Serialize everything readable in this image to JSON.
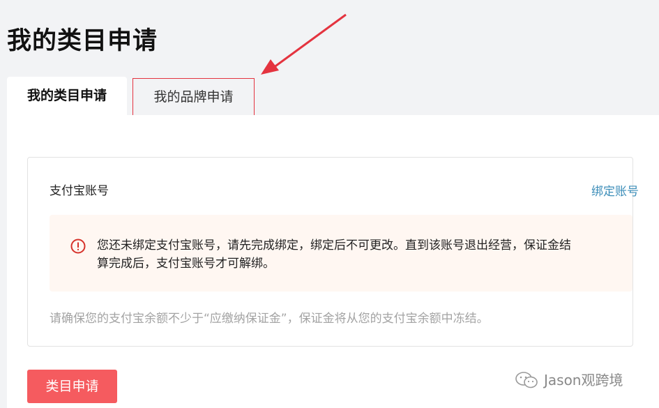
{
  "page": {
    "title": "我的类目申请"
  },
  "tabs": [
    {
      "label": "我的类目申请",
      "active": true
    },
    {
      "label": "我的品牌申请",
      "active": false
    }
  ],
  "alipay_card": {
    "title": "支付宝账号",
    "bind_link": "绑定账号",
    "notice_icon": "exclamation-circle-icon",
    "notice_text": "您还未绑定支付宝账号，请先完成绑定，绑定后不可更改。直到该账号退出经营，保证金结算完成后，支付宝账号才可解绑。",
    "hint": "请确保您的支付宝余额不少于“应缴纳保证金”，保证金将从您的支付宝余额中冻结。"
  },
  "actions": {
    "apply_button": "类目申请"
  },
  "watermark": {
    "text": "Jason观跨境",
    "icon": "wechat-icon"
  },
  "colors": {
    "accent_red": "#f55b5f",
    "highlight_border": "#e4333f",
    "link_blue": "#3d8eb9",
    "notice_bg": "#fff7f2",
    "warning_icon": "#d6322b"
  }
}
